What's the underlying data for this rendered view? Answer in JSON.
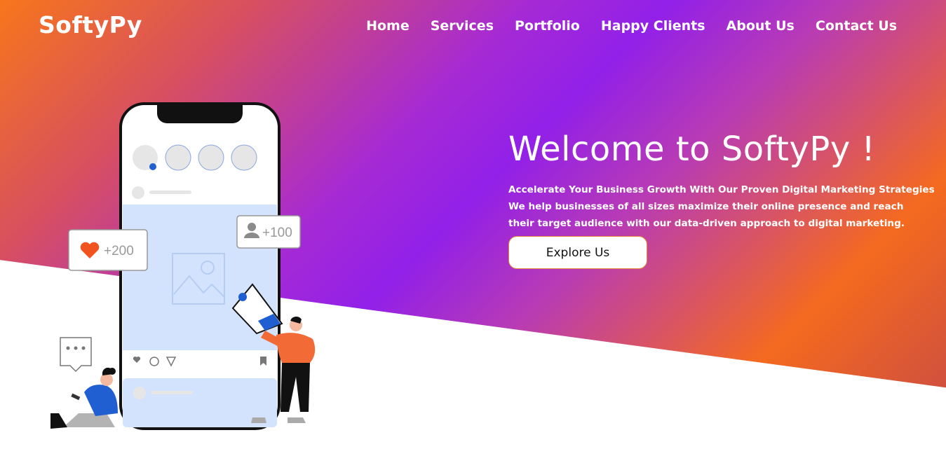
{
  "brand": {
    "logo": "SoftyPy"
  },
  "nav": {
    "items": [
      "Home",
      "Services",
      "Portfolio",
      "Happy Clients",
      "About Us",
      "Contact Us"
    ]
  },
  "hero": {
    "title": "Welcome to SoftyPy !",
    "tagline": "Accelerate Your Business Growth With Our Proven Digital Marketing Strategies",
    "description": "We help businesses of all sizes maximize their online presence and reach their target audience with our data-driven approach to digital marketing.",
    "cta_label": "Explore Us"
  },
  "illustration": {
    "likes_badge": "+200",
    "followers_badge": "+100",
    "icons": [
      "heart-icon",
      "user-icon",
      "megaphone-icon",
      "chat-bubble-icon",
      "image-icon",
      "bookmark-icon"
    ]
  },
  "colors": {
    "gradient_orange": "#f7761b",
    "gradient_purple": "#9220e8",
    "accent_blue": "#1f5fd1",
    "figure_orange": "#f26a35",
    "phone_screen": "#d3e3fd"
  }
}
